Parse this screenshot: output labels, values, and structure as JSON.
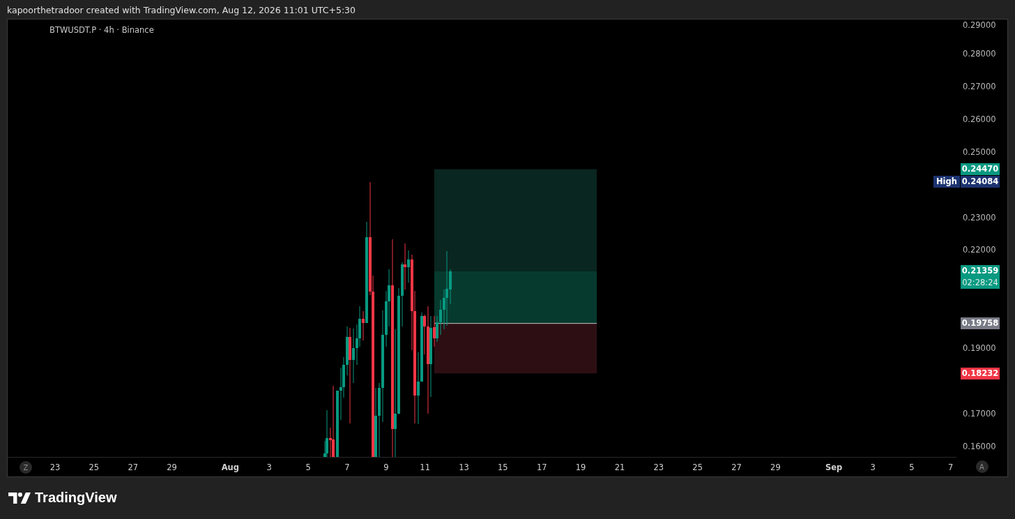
{
  "header": {
    "text": "kapoorthetradoor created with TradingView.com, Aug 12, 2026 11:01 UTC+5:30"
  },
  "chart": {
    "legend": "BTWUSDT.P · 4h · Binance",
    "price_ticks": [
      "0.29000",
      "0.28000",
      "0.27000",
      "0.26000",
      "0.25000",
      "0.23000",
      "0.22000",
      "0.19000",
      "0.17000",
      "0.16000"
    ],
    "price_labels": [
      {
        "kind": "target",
        "value": "0.24470"
      },
      {
        "kind": "high",
        "tag": "High",
        "value": "0.24084"
      },
      {
        "kind": "last",
        "value": "0.21359",
        "countdown": "02:28:24"
      },
      {
        "kind": "entry",
        "value": "0.19758"
      },
      {
        "kind": "stop",
        "value": "0.18232"
      }
    ],
    "time_ticks": [
      {
        "label": "23",
        "kind": "day"
      },
      {
        "label": "25",
        "kind": "day"
      },
      {
        "label": "27",
        "kind": "day"
      },
      {
        "label": "29",
        "kind": "day"
      },
      {
        "label": "Aug",
        "kind": "month"
      },
      {
        "label": "3",
        "kind": "day"
      },
      {
        "label": "5",
        "kind": "day"
      },
      {
        "label": "7",
        "kind": "day"
      },
      {
        "label": "9",
        "kind": "day"
      },
      {
        "label": "11",
        "kind": "day"
      },
      {
        "label": "13",
        "kind": "day"
      },
      {
        "label": "15",
        "kind": "day"
      },
      {
        "label": "17",
        "kind": "day"
      },
      {
        "label": "19",
        "kind": "day"
      },
      {
        "label": "21",
        "kind": "day"
      },
      {
        "label": "23",
        "kind": "day"
      },
      {
        "label": "25",
        "kind": "day"
      },
      {
        "label": "27",
        "kind": "day"
      },
      {
        "label": "29",
        "kind": "day"
      },
      {
        "label": "Sep",
        "kind": "month"
      },
      {
        "label": "3",
        "kind": "day"
      },
      {
        "label": "5",
        "kind": "day"
      },
      {
        "label": "7",
        "kind": "day"
      }
    ],
    "zoom_button": "Z",
    "auto_button": "A"
  },
  "footer": {
    "logo_text": "TradingView"
  }
}
